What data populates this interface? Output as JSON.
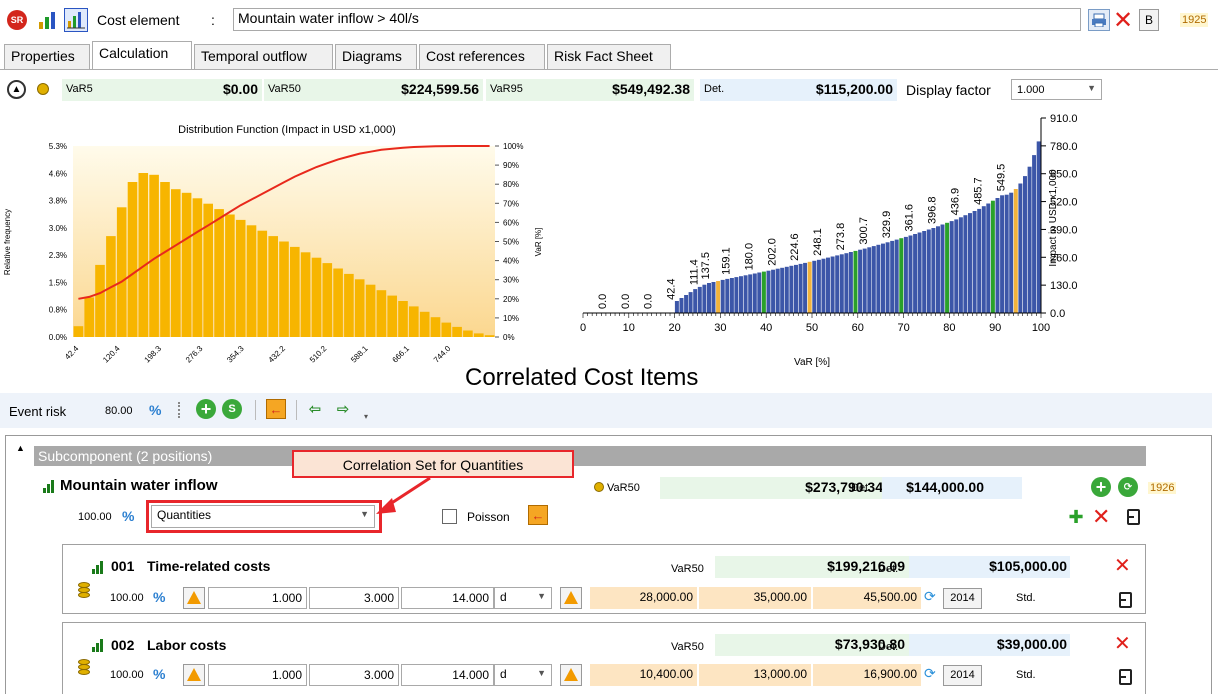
{
  "header": {
    "cost_element_label": "Cost element",
    "colon": ":",
    "cost_element_value": "Mountain water inflow > 40l/s",
    "b_button": "B",
    "id_number": "1925",
    "sr_badge": "SR"
  },
  "tabs": [
    {
      "label": "Properties"
    },
    {
      "label": "Calculation"
    },
    {
      "label": "Temporal outflow"
    },
    {
      "label": "Diagrams"
    },
    {
      "label": "Cost references"
    },
    {
      "label": "Risk Fact Sheet"
    }
  ],
  "var_bar": {
    "var5_label": "VaR5",
    "var5_value": "$0.00",
    "var50_label": "VaR50",
    "var50_value": "$224,599.56",
    "var95_label": "VaR95",
    "var95_value": "$549,492.38",
    "det_label": "Det.",
    "det_value": "$115,200.00",
    "display_factor_label": "Display factor",
    "display_factor_value": "1.000"
  },
  "chart_data": [
    {
      "type": "bar",
      "title": "Distribution Function (Impact in USD x1,000)",
      "ylabel": "Relative frequency",
      "y2label": "VaR [%]",
      "y_ticks": [
        "5.3%",
        "4.6%",
        "3.8%",
        "3.0%",
        "2.3%",
        "1.5%",
        "0.8%",
        "0.0%"
      ],
      "y2_ticks": [
        "100%",
        "90%",
        "80%",
        "70%",
        "60%",
        "50%",
        "40%",
        "30%",
        "20%",
        "10%",
        "0%"
      ],
      "x_ticks": [
        "42.4",
        "120.4",
        "198.3",
        "276.3",
        "354.3",
        "432.2",
        "510.2",
        "588.1",
        "666.1",
        "744.0"
      ],
      "ylim": [
        0,
        5.3
      ],
      "values": [
        0.3,
        1.1,
        2.0,
        2.8,
        3.6,
        4.3,
        4.55,
        4.5,
        4.3,
        4.1,
        4.0,
        3.85,
        3.7,
        3.55,
        3.4,
        3.25,
        3.1,
        2.95,
        2.8,
        2.65,
        2.5,
        2.35,
        2.2,
        2.05,
        1.9,
        1.75,
        1.6,
        1.45,
        1.3,
        1.15,
        1.0,
        0.85,
        0.7,
        0.55,
        0.4,
        0.28,
        0.18,
        0.1,
        0.05
      ],
      "cdf_percent": [
        20,
        21,
        23,
        26,
        29,
        33,
        37,
        41,
        44.5,
        48,
        51.5,
        55,
        58.5,
        62,
        65.5,
        69,
        72,
        75,
        78,
        81,
        84,
        86.5,
        89,
        91,
        93,
        94.5,
        96,
        97,
        98,
        98.6,
        99.1,
        99.5,
        99.7,
        99.85,
        99.95,
        100,
        100,
        100,
        100
      ],
      "colors": {
        "bar": "#f7b500",
        "curve": "#e8291c",
        "bg_top": "#fffbeb",
        "bg_bottom": "#fbd78f"
      }
    },
    {
      "type": "bar",
      "xlabel": "VaR [%]",
      "ylabel": "Impact in USD x1,000",
      "x_ticks": [
        "0",
        "10",
        "20",
        "30",
        "40",
        "50",
        "60",
        "70",
        "80",
        "90",
        "100"
      ],
      "y_ticks": [
        "910.0",
        "780.0",
        "650.0",
        "520.0",
        "390.0",
        "260.0",
        "130.0",
        "0.0"
      ],
      "xlim": [
        0,
        100
      ],
      "ylim": [
        0,
        910
      ],
      "annotations": [
        {
          "x": 5,
          "label": "0.0"
        },
        {
          "x": 10,
          "label": "0.0"
        },
        {
          "x": 15,
          "label": "0.0"
        },
        {
          "x": 20,
          "label": "42.4"
        },
        {
          "x": 25,
          "label": "111.4"
        },
        {
          "x": 27.5,
          "label": "137.5"
        },
        {
          "x": 32,
          "label": "159.1"
        },
        {
          "x": 37,
          "label": "180.0"
        },
        {
          "x": 42,
          "label": "202.0"
        },
        {
          "x": 47,
          "label": "224.6"
        },
        {
          "x": 52,
          "label": "248.1"
        },
        {
          "x": 57,
          "label": "273.8"
        },
        {
          "x": 62,
          "label": "300.7"
        },
        {
          "x": 67,
          "label": "329.9"
        },
        {
          "x": 72,
          "label": "361.6"
        },
        {
          "x": 77,
          "label": "396.8"
        },
        {
          "x": 82,
          "label": "436.9"
        },
        {
          "x": 87,
          "label": "485.7"
        },
        {
          "x": 92,
          "label": "549.5"
        }
      ],
      "colors": {
        "bar": "#3c56a8",
        "marker_green": "#2aa12a",
        "marker_yellow": "#f2b33d"
      },
      "green_markers_x": [
        20,
        40,
        60,
        70,
        80,
        90
      ],
      "yellow_markers_x": [
        30,
        50,
        95
      ]
    }
  ],
  "correlated_title": "Correlated Cost Items",
  "event_risk": {
    "label": "Event risk",
    "value": "80.00",
    "percent_icon": "%"
  },
  "subcomponent": {
    "header": "Subcomponent (2 positions)",
    "callout": "Correlation Set for Quantities",
    "name": "Mountain water inflow",
    "percent": "100.00",
    "correlation_set": "Quantities",
    "poisson_label": "Poisson",
    "var50_label": "VaR50",
    "var50_value": "$273,790.34",
    "det_label": "Det.",
    "det_value": "$144,000.00",
    "id_number": "1926"
  },
  "items": [
    {
      "code": "001",
      "name": "Time-related costs",
      "var50_label": "VaR50",
      "var50_value": "$199,216.09",
      "det_label": "Det.",
      "det_value": "$105,000.00",
      "percent": "100.00",
      "q1": "1.000",
      "q2": "3.000",
      "q3": "14.000",
      "unit": "d",
      "c1": "28,000.00",
      "c2": "35,000.00",
      "c3": "45,500.00",
      "year": "2014",
      "std": "Std."
    },
    {
      "code": "002",
      "name": "Labor costs",
      "var50_label": "VaR50",
      "var50_value": "$73,930.80",
      "det_label": "Det.",
      "det_value": "$39,000.00",
      "percent": "100.00",
      "q1": "1.000",
      "q2": "3.000",
      "q3": "14.000",
      "unit": "d",
      "c1": "10,400.00",
      "c2": "13,000.00",
      "c3": "16,900.00",
      "year": "2014",
      "std": "Std."
    }
  ]
}
